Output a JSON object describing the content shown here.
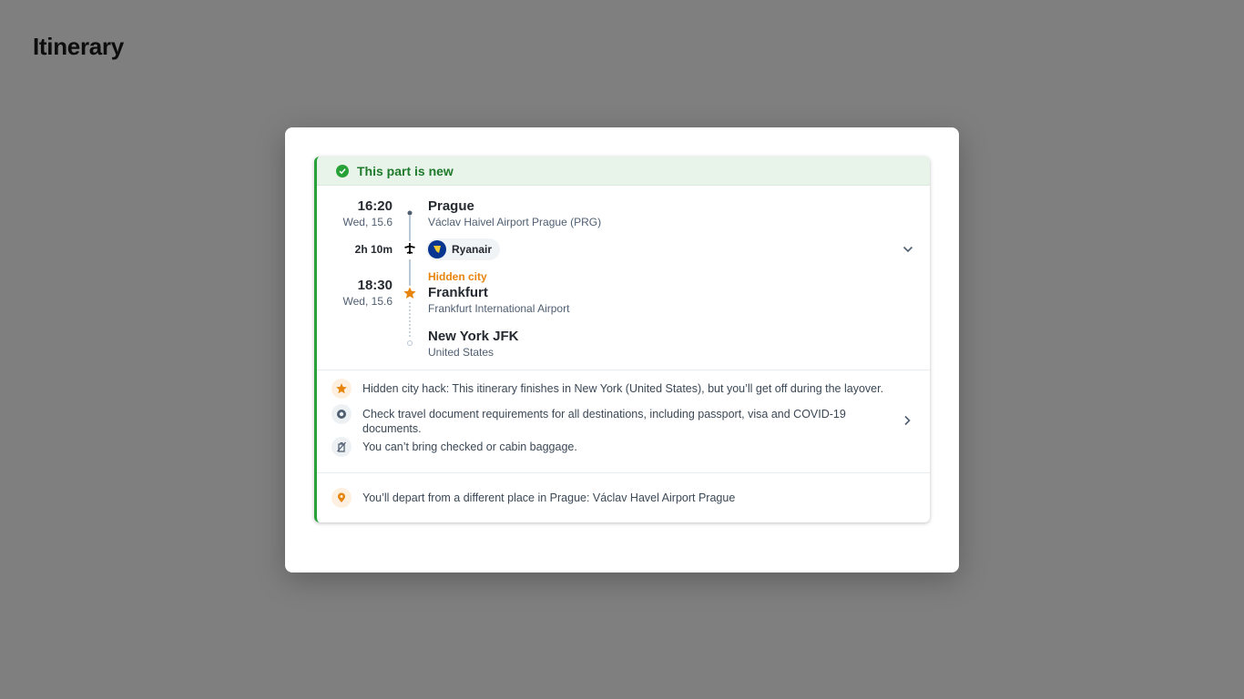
{
  "page": {
    "title": "Itinerary"
  },
  "banner": {
    "text": "This part is new"
  },
  "segment": {
    "departure": {
      "time": "16:20",
      "date": "Wed, 15.6",
      "city": "Prague",
      "airport": "Václav Haivel Airport Prague (PRG)"
    },
    "duration": "2h 10m",
    "carrier": {
      "name": "Ryanair",
      "icon": "ryanair-harp-logo"
    },
    "arrival": {
      "time": "18:30",
      "date": "Wed, 15.6",
      "label": "Hidden city",
      "city": "Frankfurt",
      "airport": "Frankfurt International Airport"
    },
    "final": {
      "city": "New York JFK",
      "country": "United States"
    }
  },
  "notices": {
    "hidden_city": "Hidden city hack: This itinerary finishes in New York (United States), but you’ll get off during the layover.",
    "documents": "Check travel document requirements for all destinations, including passport, visa and COVID-19 documents.",
    "baggage": "You can’t bring checked or cabin baggage.",
    "departure_place": "You’ll depart from a different place in Prague: Václav Havel Airport Prague"
  },
  "colors": {
    "accent_green": "#28a138",
    "hidden_city_orange": "#e7840e",
    "carrier_blue": "#073590"
  }
}
